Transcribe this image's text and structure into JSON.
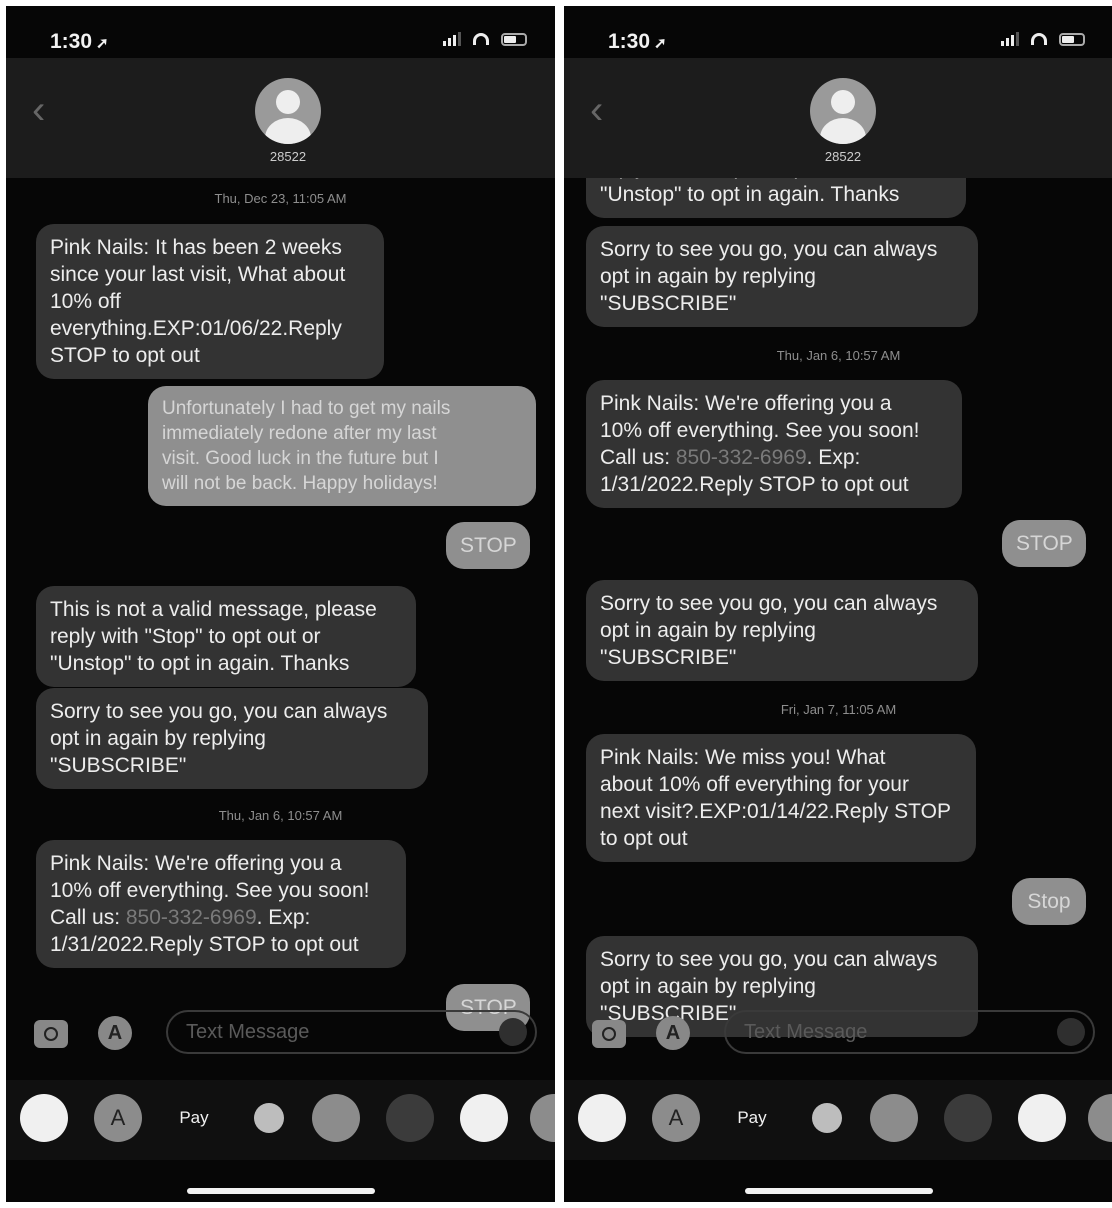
{
  "left": {
    "status": {
      "time": "1:30",
      "location_arrow": "➚"
    },
    "header": {
      "back": "‹",
      "contact": "28522"
    },
    "compose": {
      "placeholder": "Text Message"
    },
    "timestamps": [
      "Thu, Dec 23, 11:05 AM",
      "Thu, Jan 6, 10:57 AM"
    ],
    "messages": [
      {
        "from": "them",
        "text": "Pink Nails: It has been 2 weeks\nsince your last visit, What about\n10% off\neverything.EXP:01/06/22.Reply\nSTOP to opt out"
      },
      {
        "from": "me",
        "text": "Unfortunately I had to get my nails\nimmediately redone after my last\nvisit. Good luck in the future but I\nwill not be back. Happy holidays!"
      },
      {
        "from": "me",
        "text": "STOP"
      },
      {
        "from": "them",
        "text": "This is not a valid message, please\nreply with \"Stop\" to opt out or\n\"Unstop\" to opt in again. Thanks"
      },
      {
        "from": "them",
        "text": "Sorry to see you go, you can always\nopt in again by replying\n\"SUBSCRIBE\""
      },
      {
        "from": "them",
        "text_pre": "Pink Nails: We're offering you a\n10% off everything. See you soon!\nCall us: ",
        "link": "850-332-6969",
        "text_post": ". Exp:\n1/31/2022.Reply STOP to opt out"
      },
      {
        "from": "me",
        "text": "STOP"
      }
    ]
  },
  "right": {
    "status": {
      "time": "1:30",
      "location_arrow": "➚"
    },
    "header": {
      "contact": "28522"
    },
    "compose": {
      "placeholder": "Text Message"
    },
    "timestamps": [
      "Thu, Jan 6, 10:57 AM",
      "Fri, Jan 7, 11:05 AM"
    ],
    "messages": [
      {
        "from": "them",
        "text": "reply with \"Stop\" to opt out or\n\"Unstop\" to opt in again. Thanks"
      },
      {
        "from": "them",
        "text": "Sorry to see you go, you can always\nopt in again by replying\n\"SUBSCRIBE\""
      },
      {
        "from": "them",
        "text_pre": "Pink Nails: We're offering you a\n10% off everything. See you soon!\nCall us: ",
        "link": "850-332-6969",
        "text_post": ". Exp:\n1/31/2022.Reply STOP to opt out"
      },
      {
        "from": "me",
        "text": "STOP"
      },
      {
        "from": "them",
        "text": "Sorry to see you go, you can always\nopt in again by replying\n\"SUBSCRIBE\""
      },
      {
        "from": "them",
        "text": "Pink Nails: We miss you! What\nabout 10% off everything for your\nnext visit?.EXP:01/14/22.Reply STOP\nto opt out"
      },
      {
        "from": "me",
        "text": "Stop"
      },
      {
        "from": "them",
        "text": "Sorry to see you go, you can always\nopt in again by replying\n\"SUBSCRIBE\""
      }
    ]
  },
  "tray": {
    "apple_pay": "Pay",
    "app_store_glyph": "A",
    "apple_glyph": ""
  },
  "icons": {
    "camera": "camera-icon",
    "apps": "app-store-icon",
    "mic": "microphone-icon",
    "location": "location-arrow-icon",
    "photos": "photos-app-icon",
    "fitness": "activity-rings-icon",
    "search": "image-search-icon",
    "memoji": "memoji-icon",
    "music": "music-icon"
  },
  "colors": {
    "background": "#060606",
    "incoming_bubble": "#333333",
    "outgoing_bubble": "#8f8f8f",
    "text": "#ededed"
  }
}
